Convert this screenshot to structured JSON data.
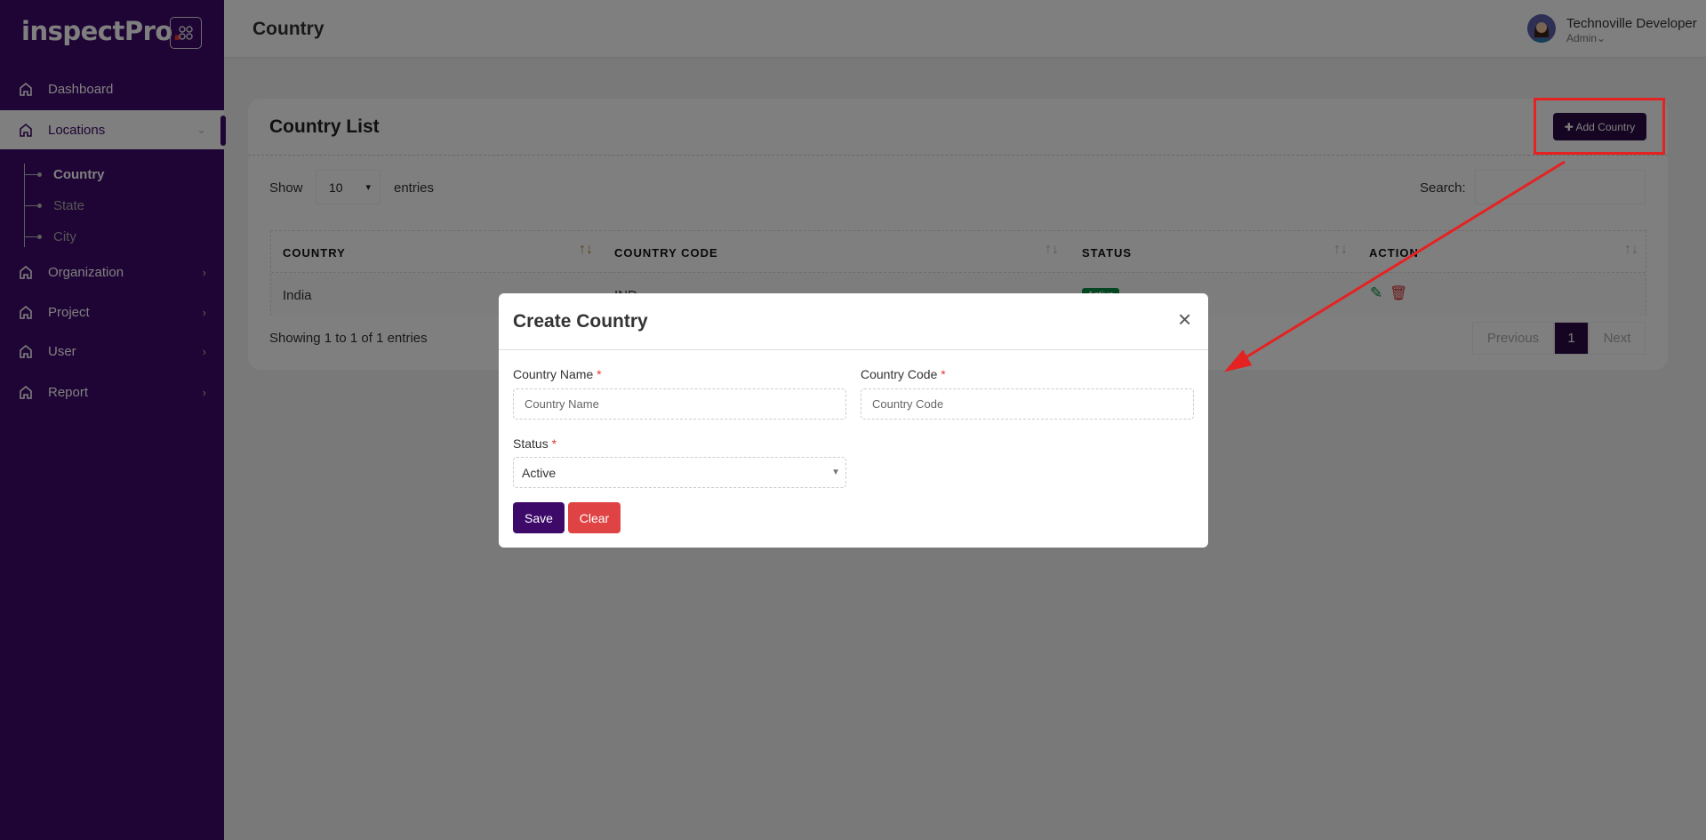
{
  "sidebar": {
    "logo": "inspectPro",
    "logo_dot": ".",
    "items": [
      {
        "label": "Dashboard"
      },
      {
        "label": "Locations"
      },
      {
        "label": "Organization"
      },
      {
        "label": "Project"
      },
      {
        "label": "User"
      },
      {
        "label": "Report"
      }
    ],
    "sub_items": [
      {
        "label": "Country"
      },
      {
        "label": "State"
      },
      {
        "label": "City"
      }
    ]
  },
  "header": {
    "title": "Country",
    "user_name": "Technoville Developer",
    "user_role": "Admin"
  },
  "card": {
    "title": "Country List",
    "add_button": "✚ Add Country",
    "show_label": "Show",
    "entries_value": "10",
    "entries_label": "entries",
    "search_label": "Search:",
    "columns": [
      "COUNTRY",
      "COUNTRY CODE",
      "STATUS",
      "ACTION"
    ],
    "rows": [
      {
        "country": "India",
        "code": "IND",
        "status": "Active"
      }
    ],
    "info": "Showing 1 to 1 of 1 entries",
    "pagination": {
      "previous": "Previous",
      "current": "1",
      "next": "Next"
    }
  },
  "modal": {
    "title": "Create Country",
    "close": "×",
    "country_name_label": "Country Name",
    "country_name_placeholder": "Country Name",
    "country_code_label": "Country Code",
    "country_code_placeholder": "Country Code",
    "required": "*",
    "status_label": "Status",
    "status_value": "Active",
    "save": "Save",
    "clear": "Clear"
  },
  "colors": {
    "brand": "#3e0a6a",
    "danger": "#e53935",
    "success": "#0b8a3e",
    "annotation": "#e52222"
  }
}
